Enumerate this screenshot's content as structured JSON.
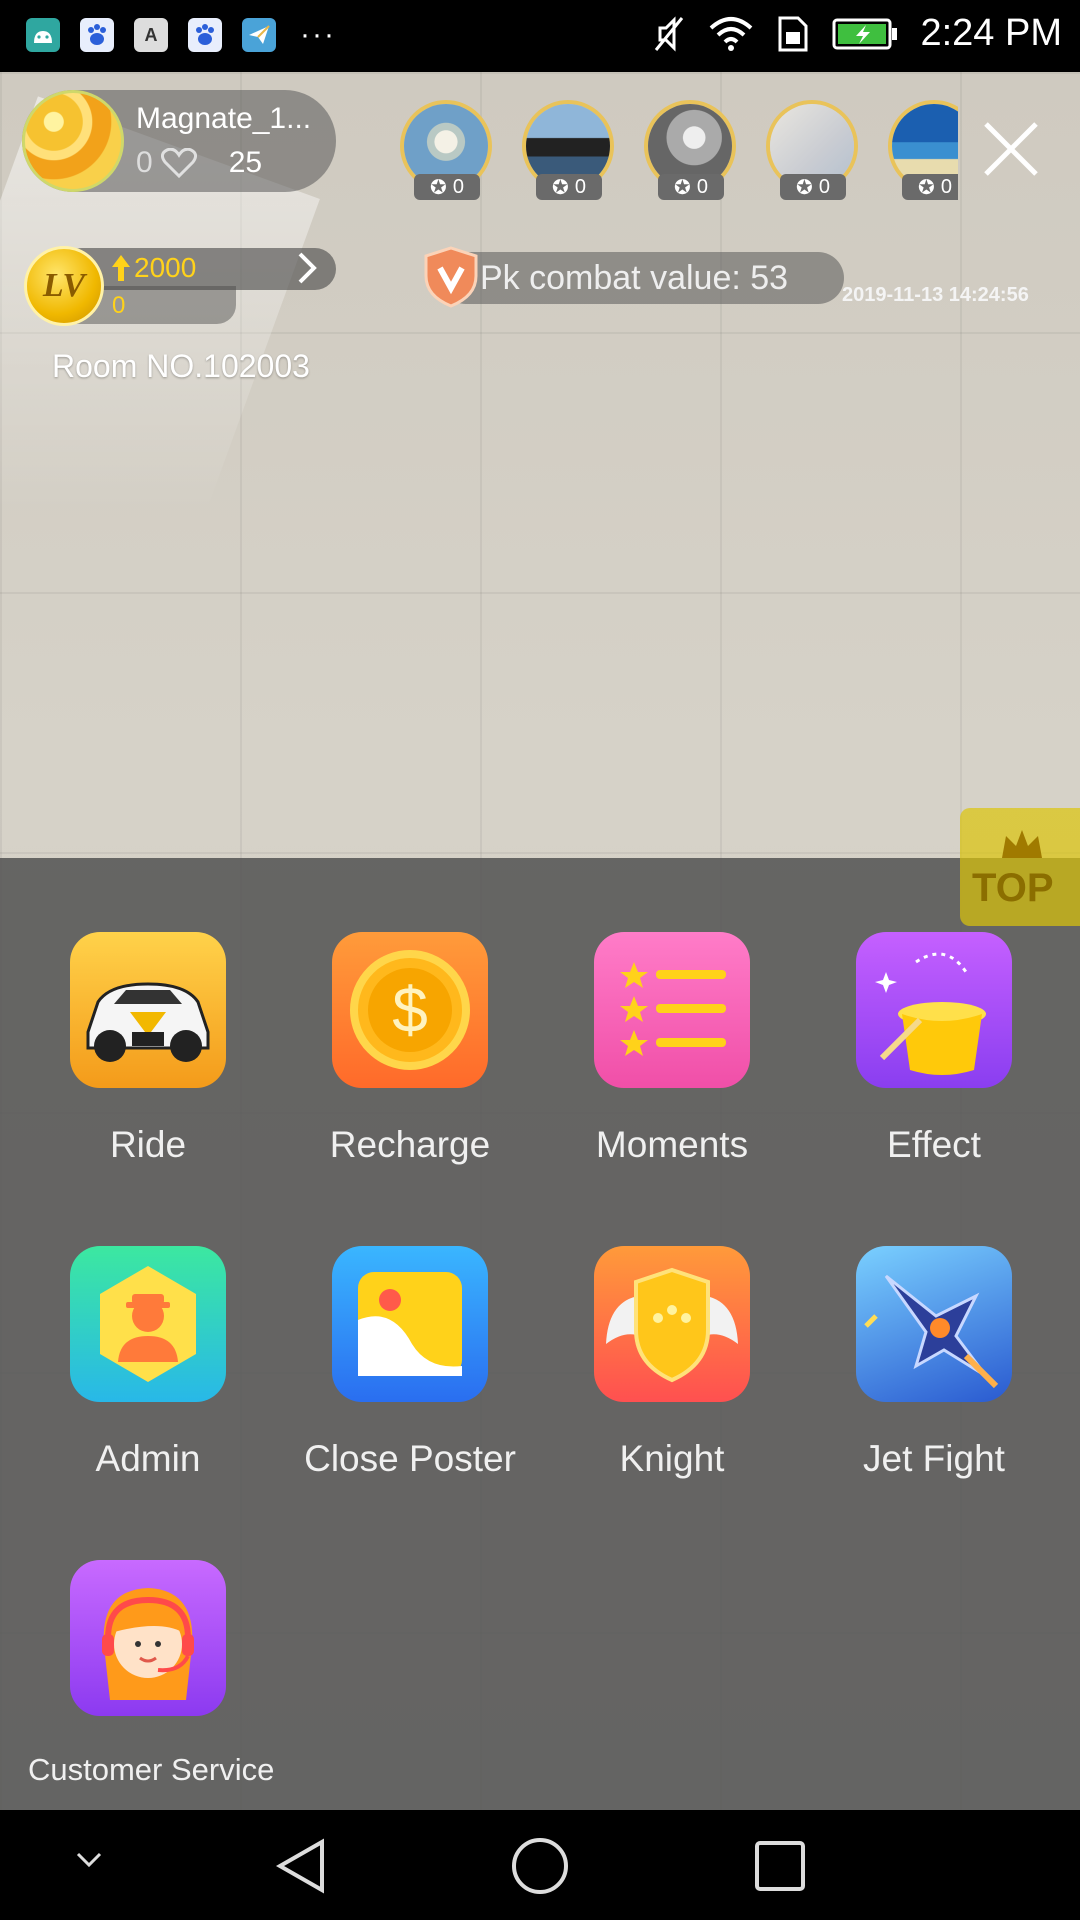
{
  "status_bar": {
    "time": "2:24 PM",
    "icons": [
      "android-app-icon",
      "baidu-app-icon",
      "font-app-icon",
      "baidu-app-icon",
      "send-app-icon",
      "more-dots-icon",
      "mute-icon",
      "wifi-icon",
      "sim-icon",
      "battery-charging-icon"
    ],
    "more": "···"
  },
  "host": {
    "name": "Magnate_1...",
    "likes": "0",
    "fans": "25"
  },
  "audience": [
    {
      "count": "0"
    },
    {
      "count": "0"
    },
    {
      "count": "0"
    },
    {
      "count": "0"
    },
    {
      "count": "0"
    }
  ],
  "level": {
    "badge": "LV",
    "target": "2000",
    "current": "0"
  },
  "room": {
    "number": "Room NO.102003"
  },
  "pk": {
    "label": "Pk combat value: 53"
  },
  "timestamp": "2019-11-13 14:24:56",
  "top_tab": {
    "label": "TOP"
  },
  "menu": {
    "items": [
      {
        "label": "Ride",
        "icon": "sports-car-icon"
      },
      {
        "label": "Recharge",
        "icon": "dollar-coin-icon"
      },
      {
        "label": "Moments",
        "icon": "star-list-icon"
      },
      {
        "label": "Effect",
        "icon": "magic-hat-icon"
      },
      {
        "label": "Admin",
        "icon": "admin-person-icon"
      },
      {
        "label": "Close Poster",
        "icon": "poster-image-icon"
      },
      {
        "label": "Knight",
        "icon": "winged-shield-icon"
      },
      {
        "label": "Jet Fight",
        "icon": "jet-fighter-icon"
      },
      {
        "label": "Customer Service",
        "icon": "headset-agent-icon"
      }
    ]
  }
}
